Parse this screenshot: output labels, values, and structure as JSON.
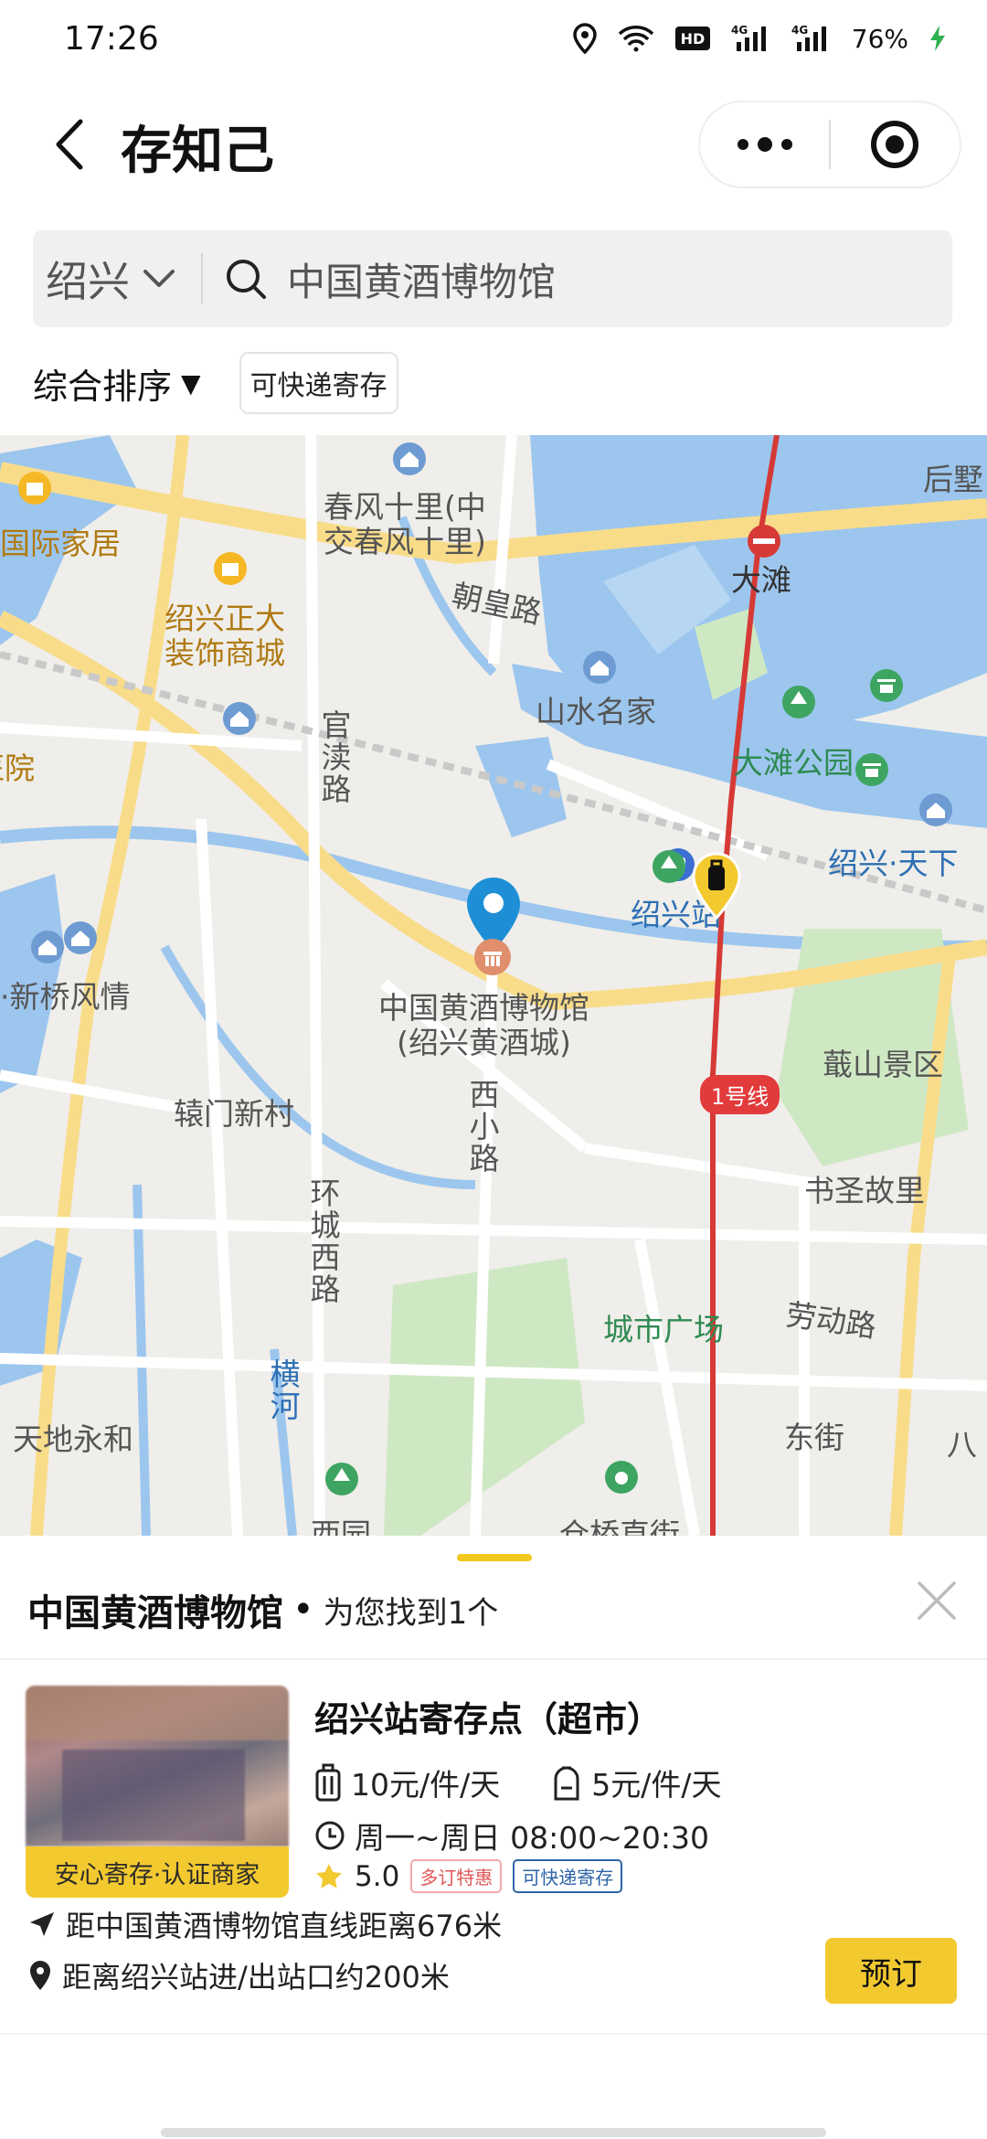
{
  "status_bar": {
    "time": "17:26",
    "battery": "76%",
    "icons": [
      "location-icon",
      "wifi-icon",
      "hd-icon",
      "signal-4g-icon",
      "signal-4g-icon",
      "charging-icon"
    ]
  },
  "nav": {
    "title": "存知己"
  },
  "search": {
    "city": "绍兴",
    "query": "中国黄酒博物馆"
  },
  "filters": {
    "sort_label": "综合排序",
    "chip_label": "可快递寄存"
  },
  "map": {
    "labels": {
      "chunfeng": "春风十里(中\n交春风十里)",
      "guoji": "国际家居",
      "zhengda": "绍兴正大\n装饰商城",
      "chaohuang": "朝皇路",
      "shanshui": "山水名家",
      "guandu": "官渎路",
      "dashan": "大滩",
      "dashan_park": "大滩公园",
      "houye": "后墅",
      "tianxia": "绍兴·天下",
      "yiyuan": "医院",
      "xinqiao": "·新桥风情",
      "station": "绍兴站",
      "museum": "中国黄酒博物馆\n(绍兴黄酒城)",
      "jishan": "蕺山景区",
      "yuanmen": "辕门新村",
      "xixiao": "西小路",
      "shusheng": "书圣故里",
      "huancheng": "环城西路",
      "chengshi": "城市广场",
      "laodong": "劳动路",
      "hengwhe": "横河",
      "tiandi": "天地永和",
      "dongjie": "东街",
      "ba": "八",
      "xiyuan": "西园",
      "jinqiao": "仓桥直街"
    },
    "metro_line": "1号线"
  },
  "sheet": {
    "title": "中国黄酒博物馆",
    "dot": "•",
    "count_text": "为您找到1个"
  },
  "store": {
    "name": "绍兴站寄存点（超市）",
    "badge": "安心寄存·认证商家",
    "price_luggage": "10元/件/天",
    "price_bag": "5元/件/天",
    "hours": "周一~周日 08:00~20:30",
    "rating": "5.0",
    "tag_discount": "多订特惠",
    "tag_express": "可快递寄存",
    "distance_museum": "距中国黄酒博物馆直线距离676米",
    "distance_station": "距离绍兴站进/出站口约200米",
    "book_label": "预订"
  },
  "colors": {
    "accent": "#f3c930",
    "map_water": "#9cc6ee",
    "metro": "#d63a36",
    "road": "#ffffff",
    "main_road": "#f9dc8a",
    "green_area": "#cfe8c4"
  }
}
